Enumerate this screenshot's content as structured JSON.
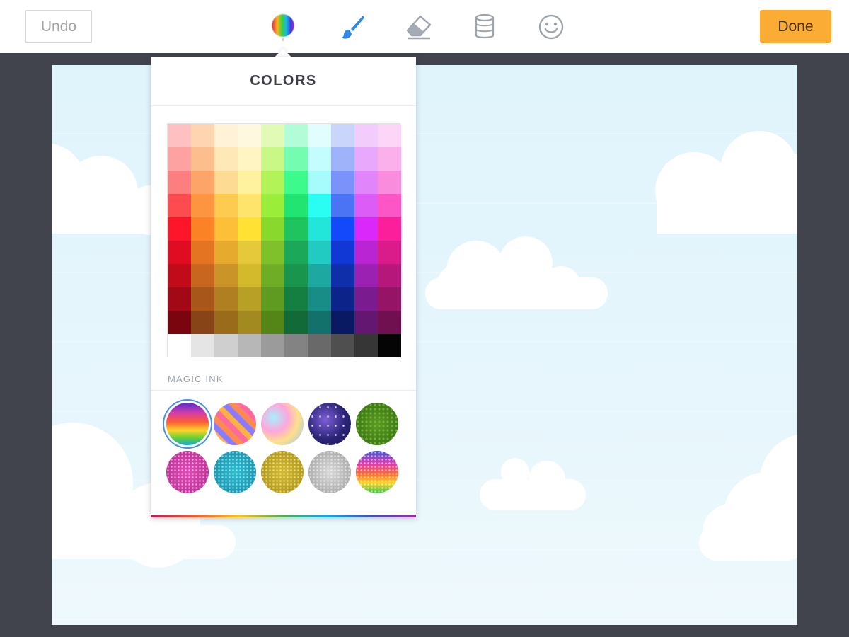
{
  "toolbar": {
    "undo_label": "Undo",
    "done_label": "Done",
    "accent_color": "#fbac34",
    "tools": [
      "rainbow-colors-icon",
      "brush-icon",
      "eraser-icon",
      "paint-bucket-icon",
      "smiley-sticker-icon"
    ],
    "active_tool": "rainbow-colors-icon"
  },
  "popup": {
    "title": "COLORS",
    "magic_label": "MAGIC INK",
    "palette": [
      [
        "#fec0c0",
        "#fed5b0",
        "#fff2d6",
        "#fef8de",
        "#e1fab5",
        "#b2fdd8",
        "#e2fdfd",
        "#c9d5fb",
        "#f2cdfc",
        "#fdd5f6"
      ],
      [
        "#fea1a1",
        "#fdbe8d",
        "#ffe8b7",
        "#fef5c2",
        "#c9f887",
        "#74fcb1",
        "#c3fdfd",
        "#9fb3fb",
        "#e8a8fc",
        "#fbb0eb"
      ],
      [
        "#fd7e7e",
        "#fda568",
        "#fddb92",
        "#fef29e",
        "#b2f457",
        "#3cfb8c",
        "#a6fcfc",
        "#7a92f9",
        "#e086fa",
        "#fa8cde"
      ],
      [
        "#fe4b4f",
        "#fd9440",
        "#fdcb50",
        "#ffe46c",
        "#9aed38",
        "#22e470",
        "#2afdf1",
        "#4b74f4",
        "#dc5cf8",
        "#fb55c6"
      ],
      [
        "#fd1629",
        "#fc8226",
        "#fdbe38",
        "#ffe133",
        "#88d82e",
        "#1fc45f",
        "#22e6d9",
        "#1448fb",
        "#da28fa",
        "#fb1f9b"
      ],
      [
        "#e00c21",
        "#e57422",
        "#e5aa2e",
        "#e6c83b",
        "#7ec12a",
        "#1ca859",
        "#21cbc2",
        "#1137d4",
        "#b925d2",
        "#d91c8a"
      ],
      [
        "#c10b1b",
        "#c8651e",
        "#ca9428",
        "#d2ba2c",
        "#6fad26",
        "#19954e",
        "#1da8a1",
        "#0f2eaa",
        "#9a21b1",
        "#b5187a"
      ],
      [
        "#a30816",
        "#a85619",
        "#b07f22",
        "#b89f25",
        "#5f9b20",
        "#157f42",
        "#188d87",
        "#0c238a",
        "#7b1b90",
        "#961466"
      ],
      [
        "#7a050f",
        "#874416",
        "#9a6b1b",
        "#a28a20",
        "#538517",
        "#126a38",
        "#13716c",
        "#091a63",
        "#631771",
        "#701050"
      ],
      [
        "#ffffff",
        "#e5e5e5",
        "#cfcfcf",
        "#b7b7b7",
        "#9b9b9b",
        "#838383",
        "#696969",
        "#4f4f4f",
        "#363636",
        "#050505"
      ]
    ],
    "magic_inks": [
      {
        "name": "rainbow-stripes",
        "selected": true
      },
      {
        "name": "diagonal-candy",
        "selected": false
      },
      {
        "name": "holographic",
        "selected": false
      },
      {
        "name": "galaxy",
        "selected": false
      },
      {
        "name": "grass",
        "selected": false
      },
      {
        "name": "pink-glitter",
        "selected": false
      },
      {
        "name": "cyan-glitter",
        "selected": false
      },
      {
        "name": "gold-glitter",
        "selected": false
      },
      {
        "name": "silver-glitter",
        "selected": false
      },
      {
        "name": "rainbow-glitter",
        "selected": false
      }
    ]
  }
}
